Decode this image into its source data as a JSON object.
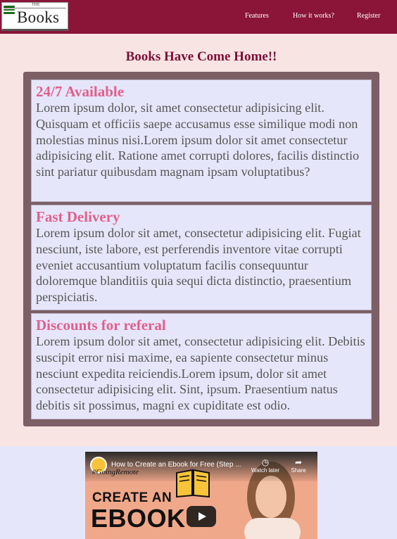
{
  "header": {
    "logo_small": "THE",
    "logo_main": "Books",
    "nav": {
      "features": "Features",
      "how": "How it works?",
      "register": "Register"
    }
  },
  "hero": {
    "title": "Books Have Come Home!!"
  },
  "features": [
    {
      "title": "24/7 Available",
      "text": "Lorem ipsum dolor, sit amet consectetur adipisicing elit. Quisquam et officiis saepe accusamus esse similique modi non molestias minus nisi.Lorem ipsum dolor sit amet consectetur adipisicing elit. Ratione amet corrupti dolores, facilis distinctio sint pariatur quibusdam magnam ipsam voluptatibus?"
    },
    {
      "title": "Fast Delivery",
      "text": "Lorem ipsum dolor sit amet, consectetur adipisicing elit. Fugiat nesciunt, iste labore, est perferendis inventore vitae corrupti eveniet accusantium voluptatum facilis consequuntur doloremque blanditiis quia sequi dicta distinctio, praesentium perspiciatis."
    },
    {
      "title": "Discounts for referal",
      "text": "Lorem ipsum dolor sit amet, consectetur adipisicing elit. Debitis suscipit error nisi maxime, ea sapiente consectetur minus nesciunt expedita reiciendis.Lorem ipsum, dolor sit amet consectetur adipisicing elit. Sint, ipsum. Praesentium natus debitis sit possimus, magni ex cupiditate est odio."
    }
  ],
  "video": {
    "title": "How to Create an Ebook for Free (Step ...",
    "watch_later": "Watch later",
    "share": "Share",
    "channel": "#GoingRemote",
    "line1": "CREATE AN",
    "line2": "EBOOK"
  },
  "colors": {
    "navbar": "#8a1538",
    "page_background": "#f9e4e4",
    "panel": "#7c5e65",
    "card": "#e6e6fa",
    "card_title": "#e0608c",
    "hero_title": "#7a1036"
  }
}
